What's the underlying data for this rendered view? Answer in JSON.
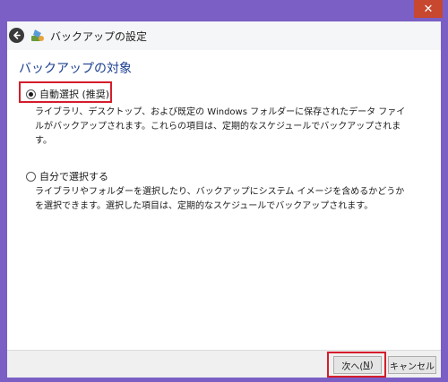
{
  "window": {
    "title": "バックアップの設定",
    "close_symbol": "✕"
  },
  "page": {
    "heading": "バックアップの対象"
  },
  "options": [
    {
      "label": "自動選択 (推奨)",
      "selected": true,
      "description": "ライブラリ、デスクトップ、および既定の Windows フォルダーに保存されたデータ ファイルがバックアップされます。これらの項目は、定期的なスケジュールでバックアップされます。"
    },
    {
      "label": "自分で選択する",
      "selected": false,
      "description": "ライブラリやフォルダーを選択したり、バックアップにシステム イメージを含めるかどうかを選択できます。選択した項目は、定期的なスケジュールでバックアップされます。"
    }
  ],
  "buttons": {
    "next_prefix": "次へ(",
    "next_key": "N",
    "next_suffix": ")",
    "cancel": "キャンセル"
  },
  "colors": {
    "frame": "#7b5fc5",
    "highlight": "#d41d2c",
    "heading": "#1a3e8f"
  }
}
